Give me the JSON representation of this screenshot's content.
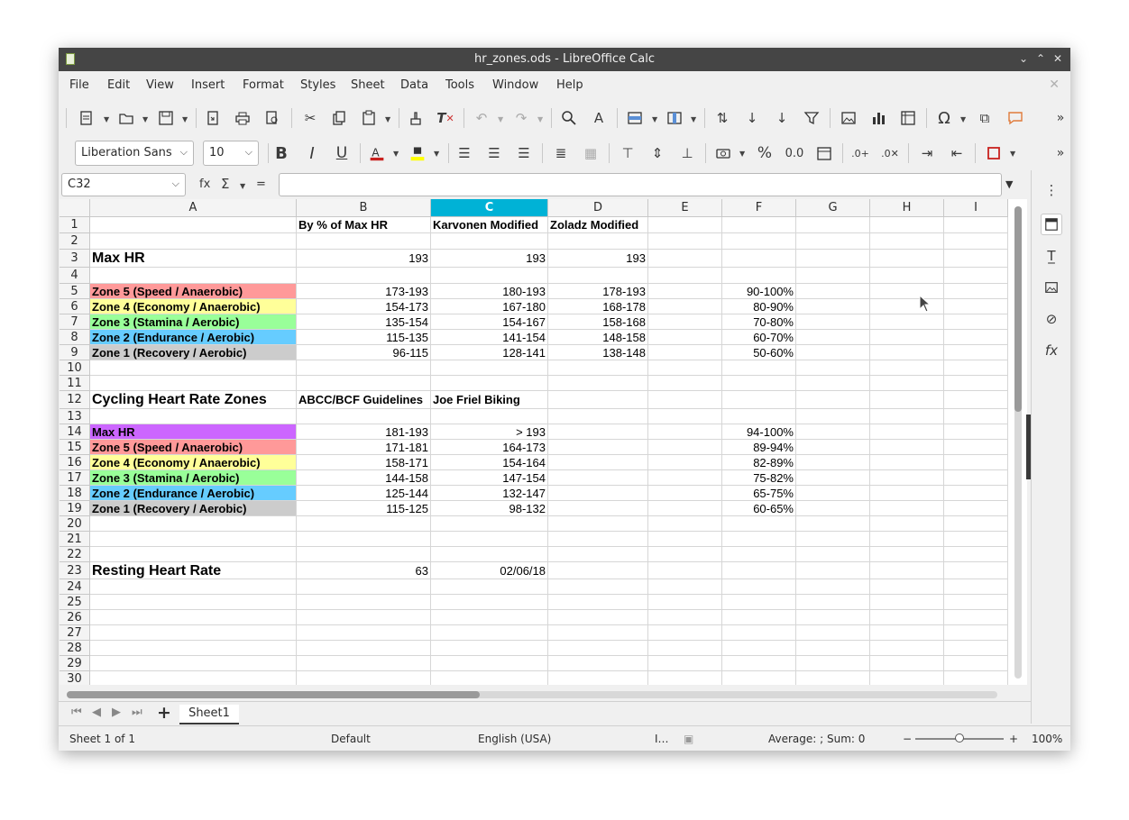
{
  "window": {
    "title": "hr_zones.ods - LibreOffice Calc"
  },
  "menu": [
    "File",
    "Edit",
    "View",
    "Insert",
    "Format",
    "Styles",
    "Sheet",
    "Data",
    "Tools",
    "Window",
    "Help"
  ],
  "toolbar": {
    "font_name": "Liberation Sans",
    "font_size": "10",
    "bold_label": "B",
    "italic_label": "I",
    "underline_label": "U"
  },
  "formula_bar": {
    "cell_ref": "C32",
    "fx_label": "fx",
    "sum_label": "Σ",
    "equals_label": "=",
    "content": ""
  },
  "columns": [
    "A",
    "B",
    "C",
    "D",
    "E",
    "F",
    "G",
    "H",
    "I"
  ],
  "selected_column": "C",
  "rows": [
    {
      "n": "1",
      "cells": {
        "B": "By % of Max HR",
        "C": "Karvonen Modified",
        "D": "Zoladz Modified"
      }
    },
    {
      "n": "2",
      "cells": {}
    },
    {
      "n": "3",
      "cells": {
        "A": "Max HR",
        "B": "193",
        "C": "193",
        "D": "193"
      }
    },
    {
      "n": "4",
      "cells": {}
    },
    {
      "n": "5",
      "cells": {
        "A": "Zone 5 (Speed / Anaerobic)",
        "B": "173-193",
        "C": "180-193",
        "D": "178-193",
        "F": "90-100%"
      }
    },
    {
      "n": "6",
      "cells": {
        "A": "Zone 4 (Economy / Anaerobic)",
        "B": "154-173",
        "C": "167-180",
        "D": "168-178",
        "F": "80-90%"
      }
    },
    {
      "n": "7",
      "cells": {
        "A": "Zone 3 (Stamina / Aerobic)",
        "B": "135-154",
        "C": "154-167",
        "D": "158-168",
        "F": "70-80%"
      }
    },
    {
      "n": "8",
      "cells": {
        "A": "Zone 2 (Endurance / Aerobic)",
        "B": "115-135",
        "C": "141-154",
        "D": "148-158",
        "F": "60-70%"
      }
    },
    {
      "n": "9",
      "cells": {
        "A": "Zone 1 (Recovery / Aerobic)",
        "B": "96-115",
        "C": "128-141",
        "D": "138-148",
        "F": "50-60%"
      }
    },
    {
      "n": "10",
      "cells": {}
    },
    {
      "n": "11",
      "cells": {}
    },
    {
      "n": "12",
      "cells": {
        "A": "Cycling Heart Rate Zones",
        "B": "ABCC/BCF Guidelines",
        "C": "Joe Friel Biking"
      }
    },
    {
      "n": "13",
      "cells": {}
    },
    {
      "n": "14",
      "cells": {
        "A": "Max HR",
        "B": "181-193",
        "C": "> 193",
        "F": "94-100%"
      }
    },
    {
      "n": "15",
      "cells": {
        "A": "Zone 5 (Speed / Anaerobic)",
        "B": "171-181",
        "C": "164-173",
        "F": "89-94%"
      }
    },
    {
      "n": "16",
      "cells": {
        "A": "Zone 4 (Economy / Anaerobic)",
        "B": "158-171",
        "C": "154-164",
        "F": "82-89%"
      }
    },
    {
      "n": "17",
      "cells": {
        "A": "Zone 3 (Stamina / Aerobic)",
        "B": "144-158",
        "C": "147-154",
        "F": "75-82%"
      }
    },
    {
      "n": "18",
      "cells": {
        "A": "Zone 2 (Endurance / Aerobic)",
        "B": "125-144",
        "C": "132-147",
        "F": "65-75%"
      }
    },
    {
      "n": "19",
      "cells": {
        "A": "Zone 1 (Recovery / Aerobic)",
        "B": "115-125",
        "C": "98-132",
        "F": "60-65%"
      }
    },
    {
      "n": "20",
      "cells": {}
    },
    {
      "n": "21",
      "cells": {}
    },
    {
      "n": "22",
      "cells": {}
    },
    {
      "n": "23",
      "cells": {
        "A": "Resting Heart Rate",
        "B": "63",
        "C": "02/06/18"
      }
    },
    {
      "n": "24",
      "cells": {}
    },
    {
      "n": "25",
      "cells": {}
    },
    {
      "n": "26",
      "cells": {}
    },
    {
      "n": "27",
      "cells": {}
    },
    {
      "n": "28",
      "cells": {}
    },
    {
      "n": "29",
      "cells": {}
    },
    {
      "n": "30",
      "cells": {}
    }
  ],
  "zone_colors": {
    "zone5": "#ff9999",
    "zone4": "#ffff99",
    "zone3": "#99ff99",
    "zone2": "#66ccff",
    "zone1": "#cccccc",
    "max": "#cc66ff",
    "selected_column": "#00b2d6"
  },
  "tabs": {
    "add_label": "+",
    "sheet_name": "Sheet1"
  },
  "status": {
    "sheet": "Sheet 1 of 1",
    "style": "Default",
    "language": "English (USA)",
    "summary": "Average: ; Sum: 0",
    "zoom_minus": "−",
    "zoom_plus": "+",
    "zoom": "100%"
  }
}
